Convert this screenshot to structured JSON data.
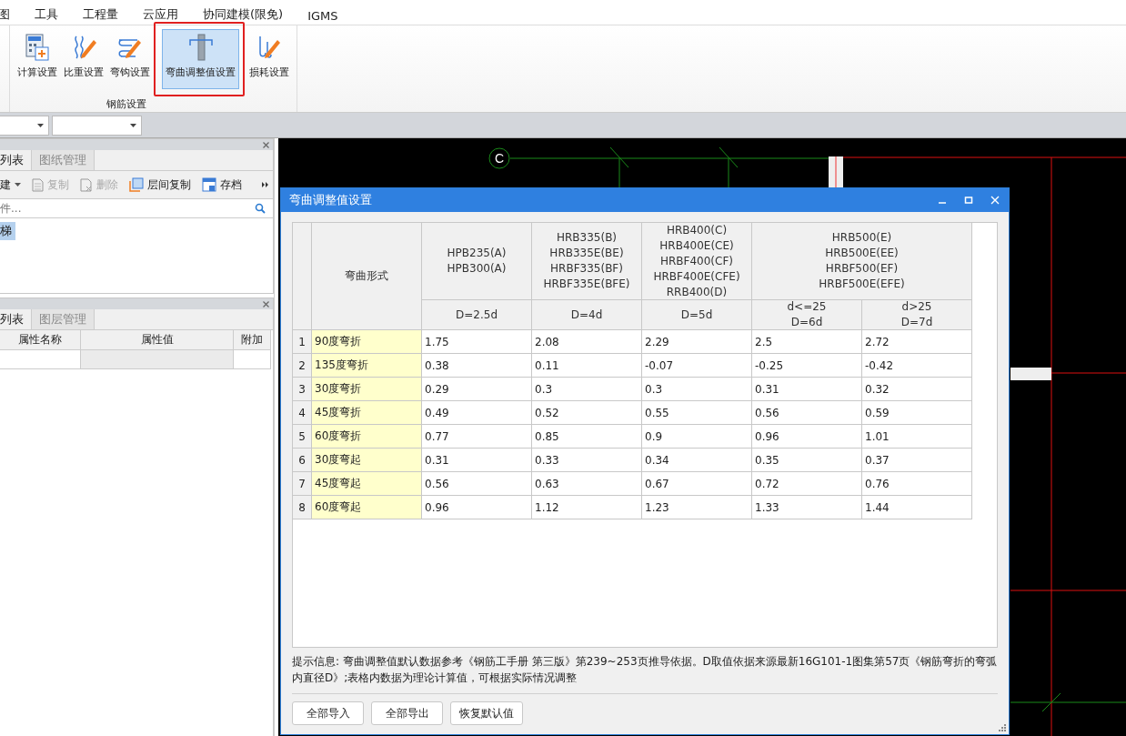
{
  "menu": [
    {
      "label": "图"
    },
    {
      "label": "工具"
    },
    {
      "label": "工程量"
    },
    {
      "label": "云应用"
    },
    {
      "label": "协同建模(限免)"
    },
    {
      "label": "IGMS"
    }
  ],
  "ribbon": {
    "group_label": "钢筋设置",
    "buttons": [
      {
        "label": "计算设置",
        "kind": "calc",
        "selected": false
      },
      {
        "label": "比重设置",
        "kind": "weight",
        "selected": false
      },
      {
        "label": "弯钩设置",
        "kind": "hook",
        "selected": false
      },
      {
        "label": "弯曲调整值设置",
        "kind": "bend",
        "selected": true
      },
      {
        "label": "损耗设置",
        "kind": "loss",
        "selected": false
      }
    ]
  },
  "component_panel": {
    "tabs": [
      {
        "label": "列表",
        "selected": true
      },
      {
        "label": "图纸管理",
        "selected": false
      }
    ],
    "toolbar": [
      {
        "label": "建",
        "kind": "new",
        "disabled": false
      },
      {
        "label": "复制",
        "kind": "copy",
        "disabled": true
      },
      {
        "label": "删除",
        "kind": "delete",
        "disabled": true
      },
      {
        "label": "层间复制",
        "kind": "floorcopy",
        "disabled": false
      },
      {
        "label": "存档",
        "kind": "save",
        "disabled": false
      }
    ],
    "search": {
      "placeholder": "件..."
    },
    "tree": [
      {
        "label": "梯",
        "selected": true
      }
    ]
  },
  "property_panel": {
    "tabs": [
      {
        "label": "列表",
        "selected": true
      },
      {
        "label": "图层管理",
        "selected": false
      }
    ],
    "columns": [
      "属性名称",
      "属性值",
      "附加"
    ]
  },
  "canvas": {
    "axis_label": "C"
  },
  "dialog": {
    "title": "弯曲调整值设置",
    "table": {
      "name_header": "弯曲形式",
      "groups": [
        {
          "grades": [
            "HPB235(A)",
            "HPB300(A)"
          ],
          "subheads": [
            [
              "D=2.5d"
            ]
          ]
        },
        {
          "grades": [
            "HRB335(B)",
            "HRB335E(BE)",
            "HRBF335(BF)",
            "HRBF335E(BFE)"
          ],
          "subheads": [
            [
              "D=4d"
            ]
          ]
        },
        {
          "grades": [
            "HRB400(C)",
            "HRB400E(CE)",
            "HRBF400(CF)",
            "HRBF400E(CFE)",
            "RRB400(D)"
          ],
          "subheads": [
            [
              "D=5d"
            ]
          ]
        },
        {
          "grades": [
            "HRB500(E)",
            "HRB500E(EE)",
            "HRBF500(EF)",
            "HRBF500E(EFE)"
          ],
          "subheads": [
            [
              "d<=25",
              "D=6d"
            ],
            [
              "d>25",
              "D=7d"
            ]
          ]
        }
      ],
      "rows": [
        {
          "number": "1",
          "name": "90度弯折",
          "values": [
            "1.75",
            "2.08",
            "2.29",
            "2.5",
            "2.72"
          ]
        },
        {
          "number": "2",
          "name": "135度弯折",
          "values": [
            "0.38",
            "0.11",
            "-0.07",
            "-0.25",
            "-0.42"
          ]
        },
        {
          "number": "3",
          "name": "30度弯折",
          "values": [
            "0.29",
            "0.3",
            "0.3",
            "0.31",
            "0.32"
          ]
        },
        {
          "number": "4",
          "name": "45度弯折",
          "values": [
            "0.49",
            "0.52",
            "0.55",
            "0.56",
            "0.59"
          ]
        },
        {
          "number": "5",
          "name": "60度弯折",
          "values": [
            "0.77",
            "0.85",
            "0.9",
            "0.96",
            "1.01"
          ]
        },
        {
          "number": "6",
          "name": "30度弯起",
          "values": [
            "0.31",
            "0.33",
            "0.34",
            "0.35",
            "0.37"
          ]
        },
        {
          "number": "7",
          "name": "45度弯起",
          "values": [
            "0.56",
            "0.63",
            "0.67",
            "0.72",
            "0.76"
          ]
        },
        {
          "number": "8",
          "name": "60度弯起",
          "values": [
            "0.96",
            "1.12",
            "1.23",
            "1.33",
            "1.44"
          ]
        }
      ]
    },
    "hint": "提示信息: 弯曲调整值默认数据参考《钢筋工手册 第三版》第239~253页推导依据。D取值依据来源最新16G101-1图集第57页《钢筋弯折的弯弧内直径D》;表格内数据为理论计算值，可根据实际情况调整",
    "buttons": [
      "全部导入",
      "全部导出",
      "恢复默认值"
    ]
  }
}
